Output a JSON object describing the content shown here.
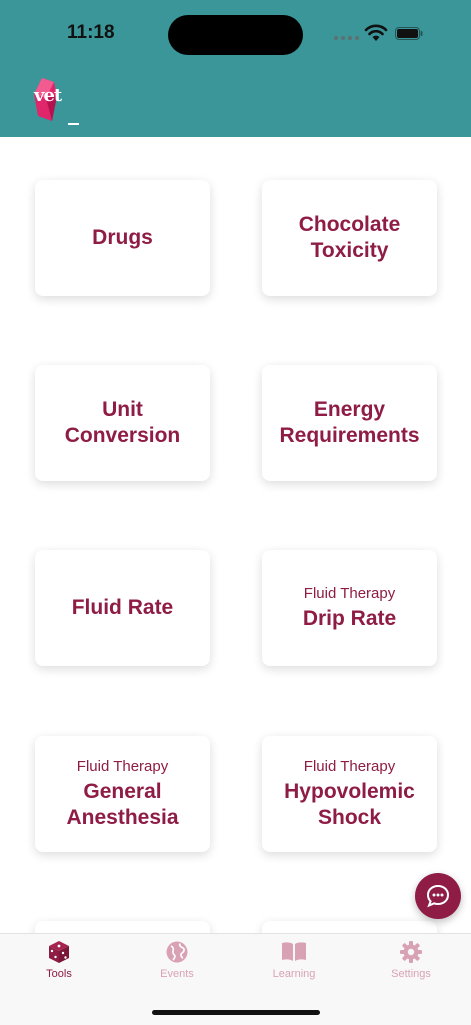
{
  "status_bar": {
    "time": "11:18"
  },
  "header": {
    "logo_text": "vet"
  },
  "cards": [
    {
      "subtitle": "",
      "title": "Drugs"
    },
    {
      "subtitle": "",
      "title": "Chocolate\nToxicity"
    },
    {
      "subtitle": "",
      "title": "Unit\nConversion"
    },
    {
      "subtitle": "",
      "title": "Energy\nRequirements"
    },
    {
      "subtitle": "",
      "title": "Fluid Rate"
    },
    {
      "subtitle": "Fluid Therapy",
      "title": "Drip Rate"
    },
    {
      "subtitle": "Fluid Therapy",
      "title": "General\nAnesthesia"
    },
    {
      "subtitle": "Fluid Therapy",
      "title": "Hypovolemic\nShock"
    }
  ],
  "tabs": [
    {
      "label": "Tools",
      "icon": "dice-icon",
      "active": true
    },
    {
      "label": "Events",
      "icon": "globe-icon",
      "active": false
    },
    {
      "label": "Learning",
      "icon": "book-icon",
      "active": false
    },
    {
      "label": "Settings",
      "icon": "gear-icon",
      "active": false
    }
  ],
  "colors": {
    "brand": "#8e1c44",
    "header": "#3a9699",
    "tab_inactive": "#d9a2b4"
  }
}
